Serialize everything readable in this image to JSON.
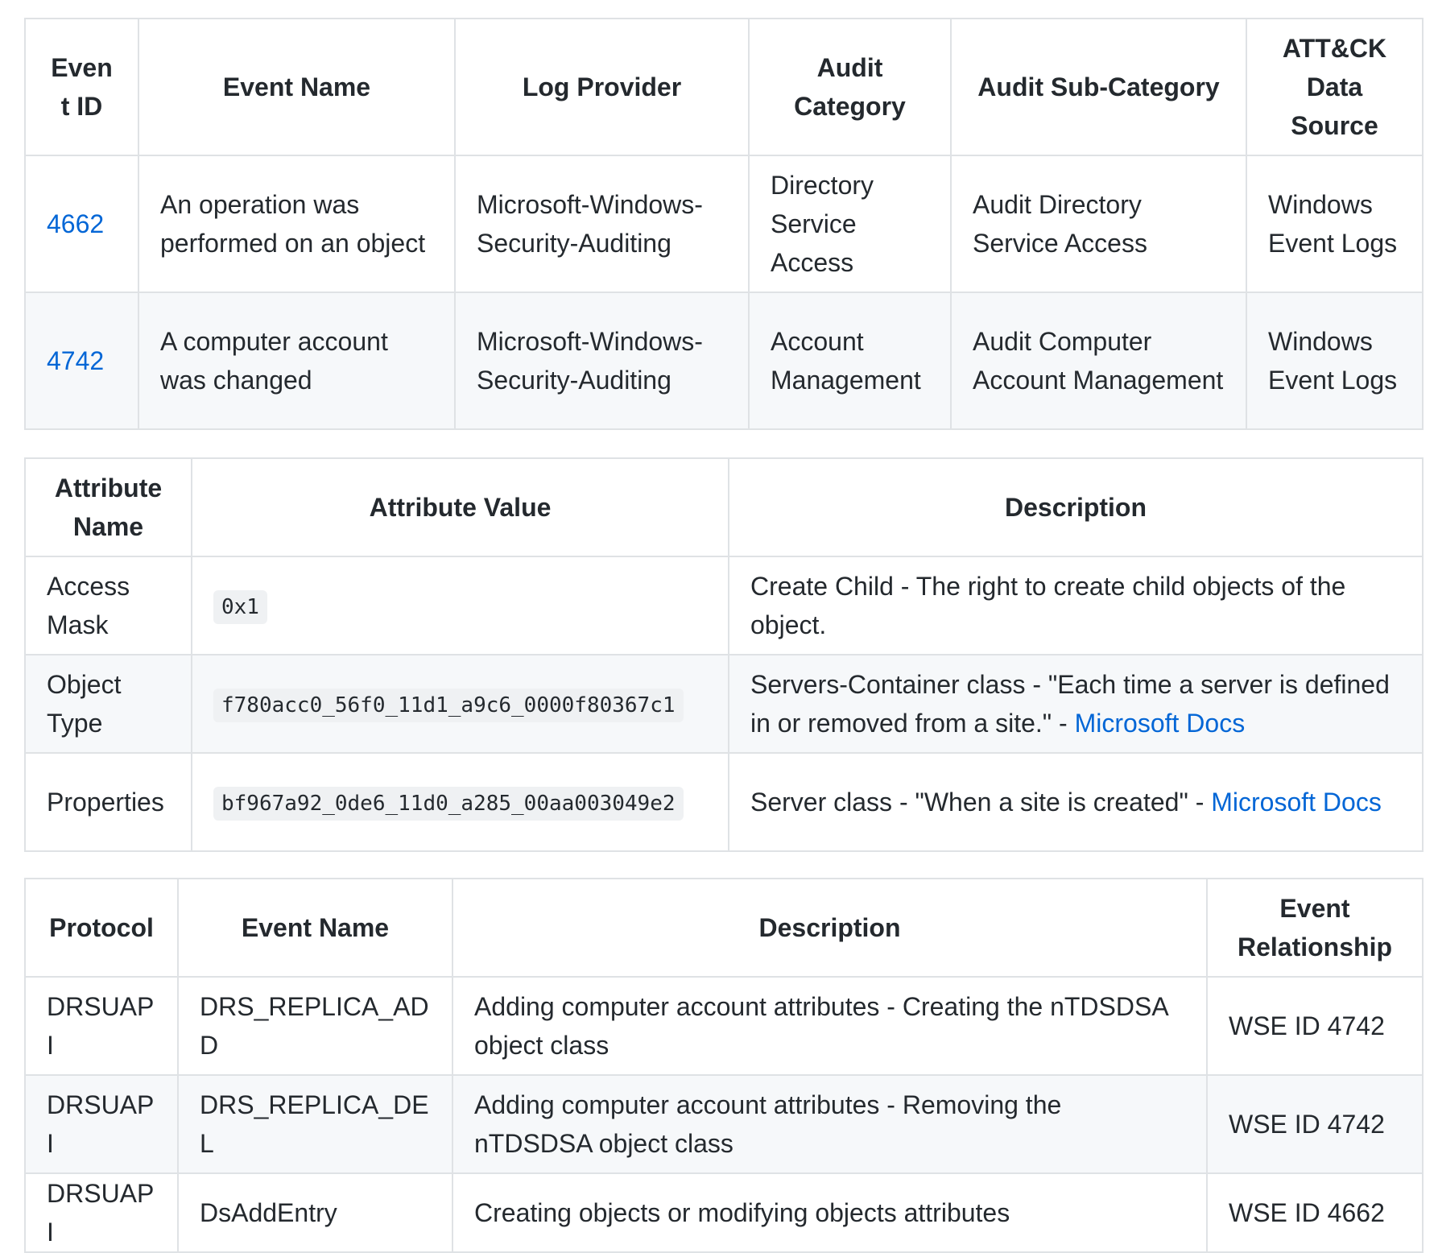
{
  "events_table": {
    "headers": [
      "Event ID",
      "Event Name",
      "Log Provider",
      "Audit Category",
      "Audit Sub-Category",
      "ATT&CK Data Source"
    ],
    "rows": [
      {
        "event_id": "4662",
        "event_name": "An operation was performed on an object",
        "log_provider": "Microsoft-Windows-Security-Auditing",
        "audit_category": "Directory Service Access",
        "audit_sub_category": "Audit Directory Service Access",
        "data_source": "Windows Event Logs"
      },
      {
        "event_id": "4742",
        "event_name": "A computer account was changed",
        "log_provider": "Microsoft-Windows-Security-Auditing",
        "audit_category": "Account Management",
        "audit_sub_category": "Audit Computer Account Management",
        "data_source": "Windows Event Logs"
      }
    ]
  },
  "attributes_table": {
    "headers": [
      "Attribute Name",
      "Attribute Value",
      "Description"
    ],
    "rows": [
      {
        "name": "Access Mask",
        "value": "0x1",
        "description": "Create Child - The right to create child objects of the object.",
        "link": ""
      },
      {
        "name": "Object Type",
        "value": "f780acc0_56f0_11d1_a9c6_0000f80367c1",
        "description": "Servers-Container class - \"Each time a server is defined in or removed from a site.\" - ",
        "link": "Microsoft Docs"
      },
      {
        "name": "Properties",
        "value": "bf967a92_0de6_11d0_a285_00aa003049e2",
        "description": "Server class - \"When a site is created\" - ",
        "link": "Microsoft Docs"
      }
    ]
  },
  "protocols_table": {
    "headers": [
      "Protocol",
      "Event Name",
      "Description",
      "Event Relationship"
    ],
    "rows": [
      {
        "protocol": "DRSUAPI",
        "event_name": "DRS_REPLICA_ADD",
        "description": "Adding computer account attributes - Creating the nTDSDSA object class",
        "relationship": "WSE ID 4742"
      },
      {
        "protocol": "DRSUAPI",
        "event_name": "DRS_REPLICA_DEL",
        "description": "Adding computer account attributes - Removing the nTDSDSA object class",
        "relationship": "WSE ID 4742"
      },
      {
        "protocol": "DRSUAPI",
        "event_name": "DsAddEntry",
        "description": "Creating objects or modifying objects attributes",
        "relationship": "WSE ID 4662"
      }
    ]
  },
  "colors": {
    "link": "#0366d6",
    "border": "#dfe2e5",
    "alt_row": "#f6f8fa",
    "code_bg": "#eff1f3",
    "text": "#24292e"
  }
}
